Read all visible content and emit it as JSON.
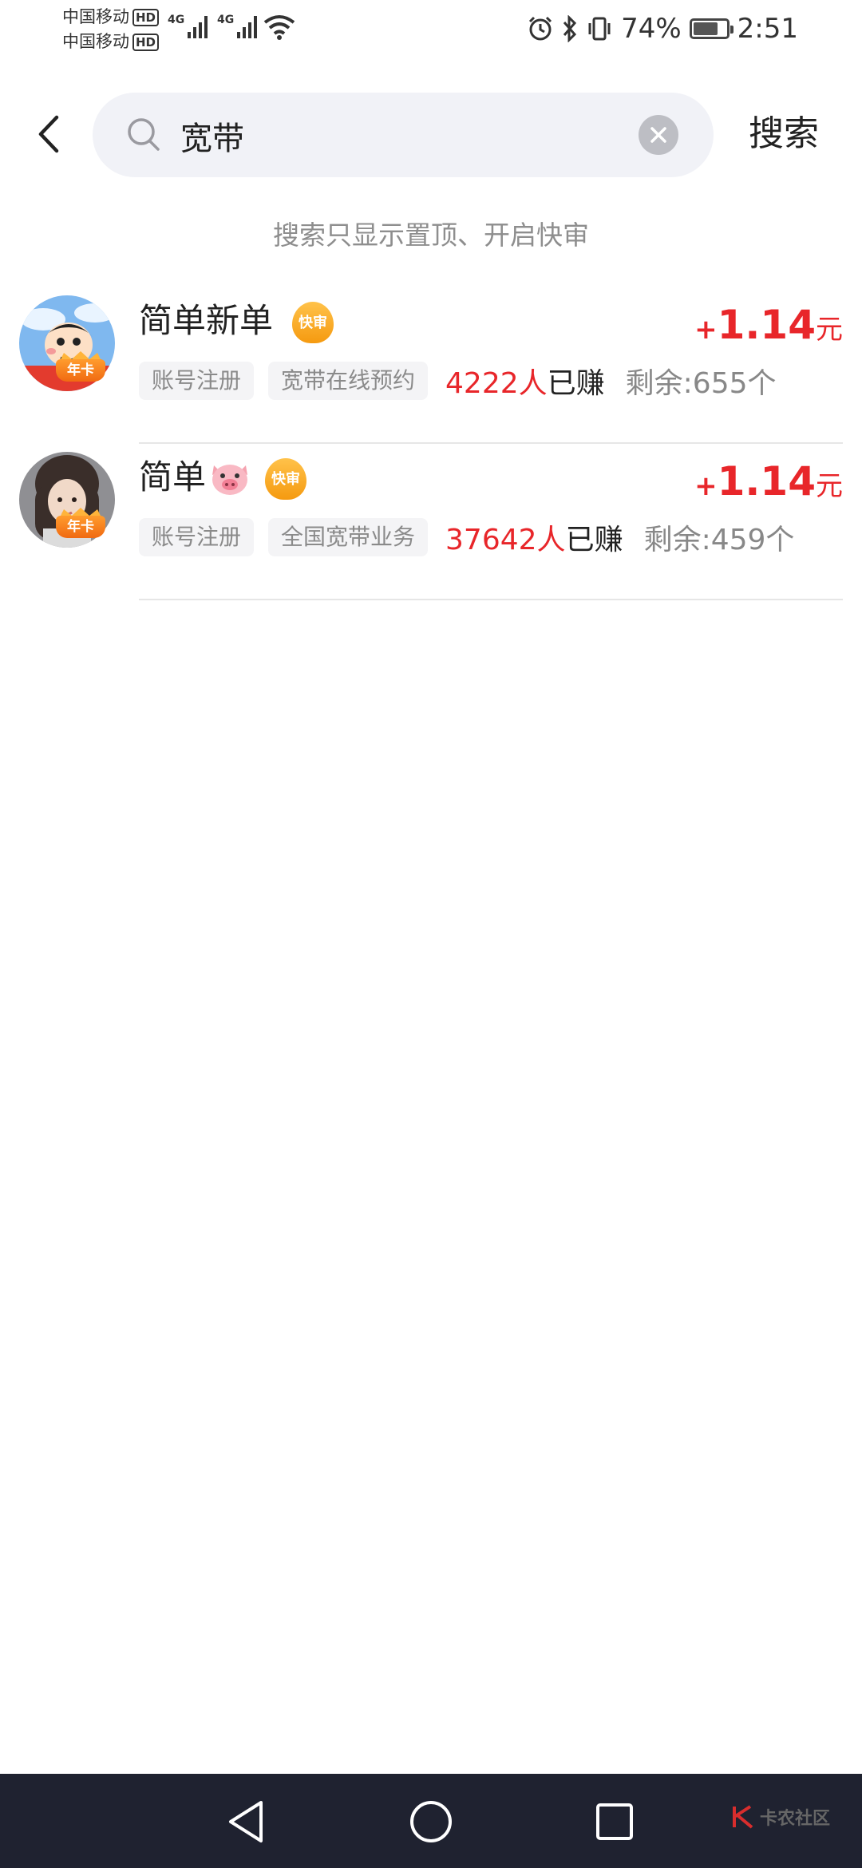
{
  "status_bar": {
    "carrier_1": "中国移动",
    "carrier_2": "中国移动",
    "hd_label": "HD",
    "network_1": "4G",
    "network_2": "4G",
    "battery_percent": "74%",
    "time": "2:51",
    "icons": [
      "alarm-icon",
      "bluetooth-icon",
      "vibrate-icon",
      "battery-icon",
      "wifi-icon"
    ]
  },
  "header": {
    "search_value": "宽带",
    "search_button": "搜索"
  },
  "hint": "搜索只显示置顶、开启快审",
  "items": [
    {
      "title": "简单新单",
      "badge": "快审",
      "avatar_badge": "年卡",
      "price_plus": "+",
      "price_value": "1.14",
      "price_unit": "元",
      "tags": [
        "账号注册",
        "宽带在线预约"
      ],
      "earned_count": "4222人",
      "earned_suffix": "已赚",
      "remaining": "剩余:655个"
    },
    {
      "title": "简单",
      "title_emoji": "pig-face-icon",
      "badge": "快审",
      "avatar_badge": "年卡",
      "price_plus": "+",
      "price_value": "1.14",
      "price_unit": "元",
      "tags": [
        "账号注册",
        "全国宽带业务"
      ],
      "earned_count": "37642人",
      "earned_suffix": "已赚",
      "remaining": "剩余:459个"
    }
  ],
  "colors": {
    "accent_red": "#e8262a",
    "badge_orange": "#f59a10",
    "nav_bg": "#1f2230"
  },
  "watermark": {
    "text": "卡农社区"
  }
}
